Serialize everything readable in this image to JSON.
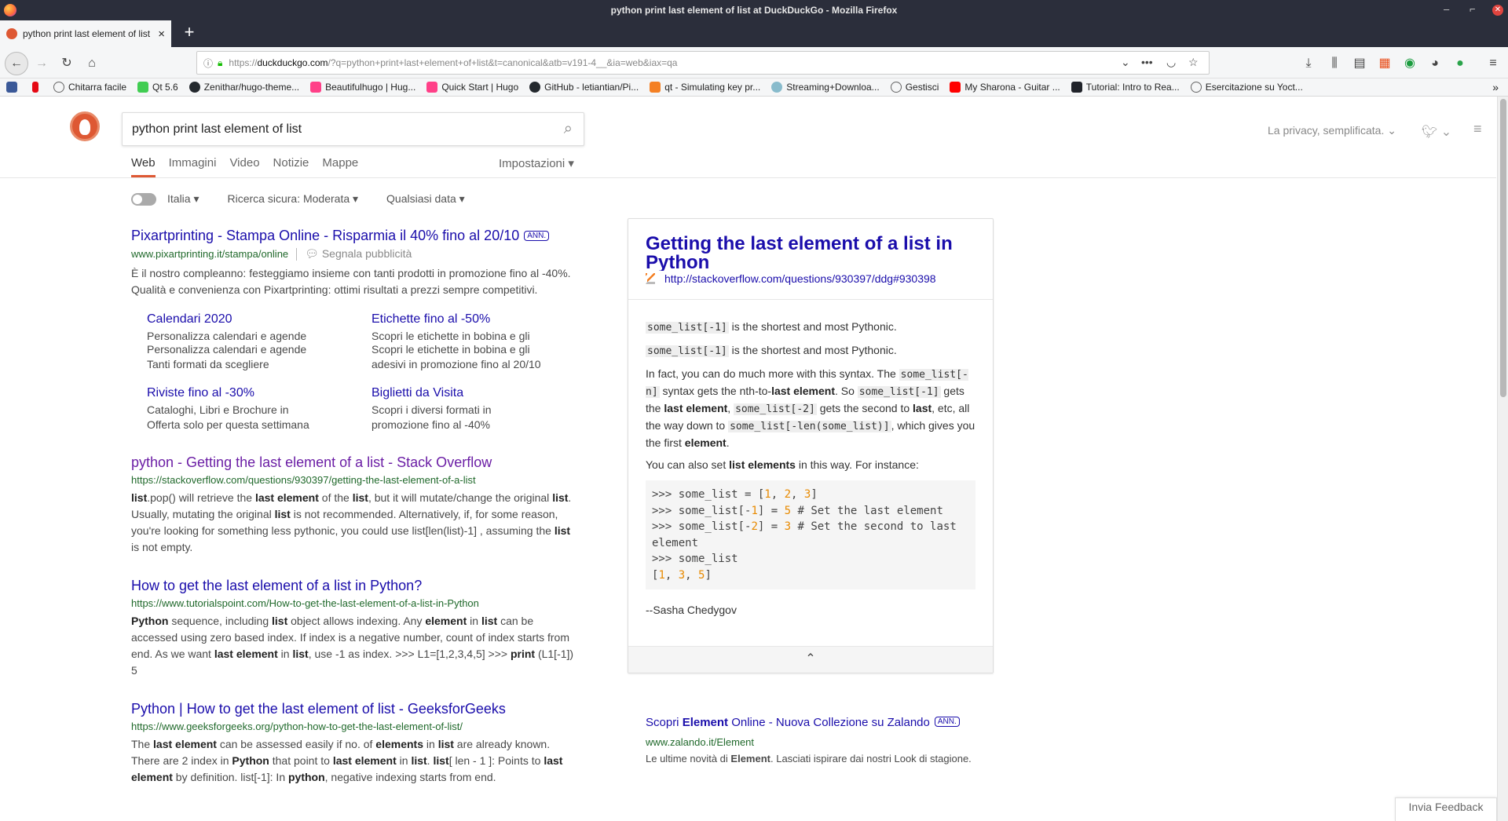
{
  "window": {
    "title": "python print last element of list at DuckDuckGo - Mozilla Firefox"
  },
  "tab": {
    "title": "python print last element of list"
  },
  "url": {
    "prefix": "https://",
    "domain": "duckduckgo.com",
    "path": "/?q=python+print+last+element+of+list&t=canonical&atb=v191-4__&ia=web&iax=qa"
  },
  "bookmarks": [
    {
      "label": "",
      "color": "#3b5998"
    },
    {
      "label": "",
      "color": "#e50914"
    },
    {
      "label": "Chitarra facile",
      "color": "#666666"
    },
    {
      "label": "Qt 5.6",
      "color": "#41cd52"
    },
    {
      "label": "Zenithar/hugo-theme...",
      "color": "#24292e"
    },
    {
      "label": "Beautifulhugo | Hug...",
      "color": "#ff4088"
    },
    {
      "label": "Quick Start | Hugo",
      "color": "#ff4088"
    },
    {
      "label": "GitHub - letiantian/Pi...",
      "color": "#24292e"
    },
    {
      "label": "qt - Simulating key pr...",
      "color": "#f48024"
    },
    {
      "label": "Streaming+Downloa...",
      "color": "#88bbcc"
    },
    {
      "label": "Gestisci",
      "color": "#666666"
    },
    {
      "label": "My Sharona - Guitar ...",
      "color": "#ff0000"
    },
    {
      "label": "Tutorial: Intro to Rea...",
      "color": "#20232a"
    },
    {
      "label": "Esercitazione su Yoct...",
      "color": "#666666"
    }
  ],
  "search": {
    "query": "python print last element of list"
  },
  "header": {
    "privacy": "La privacy, semplificata.",
    "privacy_arrow": "⌄"
  },
  "nav": {
    "web": "Web",
    "images": "Immagini",
    "video": "Video",
    "news": "Notizie",
    "maps": "Mappe",
    "settings": "Impostazioni"
  },
  "filters": {
    "region": "Italia",
    "safe": "Ricerca sicura: Moderata",
    "date": "Qualsiasi data"
  },
  "ad": {
    "title": "Pixartprinting - Stampa Online - Risparmia il 40% fino al 20/10",
    "badge": "ANN.",
    "url": "www.pixartprinting.it/stampa/online",
    "report": "Segnala pubblicità",
    "snippet": "È il nostro compleanno: festeggiamo insieme con tanti prodotti in promozione fino al -40%. Qualità e convenienza con Pixartprinting: ottimi risultati a prezzi sempre competitivi.",
    "sitelinks": [
      {
        "title": "Calendari 2020",
        "l1": "Personalizza calendari e agende",
        "l2": "Personalizza calendari e agende",
        "l3": "Tanti formati da scegliere"
      },
      {
        "title": "Etichette fino al -50%",
        "l1": "Scopri le etichette in bobina e gli",
        "l2": "Scopri le etichette in bobina e gli",
        "l3": "adesivi in promozione fino al 20/10"
      },
      {
        "title": "Riviste fino al -30%",
        "l1": "Cataloghi, Libri e Brochure in",
        "l2": "Offerta solo per questa settimana",
        "l3": ""
      },
      {
        "title": "Biglietti da Visita",
        "l1": "Scopri i diversi formati in",
        "l2": "promozione fino al -40%",
        "l3": ""
      }
    ]
  },
  "results": [
    {
      "title": "python - Getting the last element of a list - Stack Overflow",
      "url": "https://stackoverflow.com/questions/930397/getting-the-last-element-of-a-list"
    },
    {
      "title": "How to get the last element of a list in Python?",
      "url": "https://www.tutorialspoint.com/How-to-get-the-last-element-of-a-list-in-Python"
    },
    {
      "title": "Python | How to get the last element of list - GeeksforGeeks",
      "url": "https://www.geeksforgeeks.org/python-how-to-get-the-last-element-of-list/"
    }
  ],
  "infobox": {
    "title": "Getting the last element of a list in Python",
    "source_url": "http://stackoverflow.com/questions/930397/ddg#930398",
    "author": "--Sasha Chedygov",
    "collapse": "⌃"
  },
  "side_ad": {
    "title_pre": "Scopri ",
    "title_bold": "Element",
    "title_post": " Online - Nuova Collezione su Zalando",
    "badge": "ANN.",
    "url": "www.zalando.it/Element",
    "snippet_pre": "Le ultime novità di ",
    "snippet_bold": "Element",
    "snippet_post": ". Lasciati ispirare dai nostri Look di stagione."
  },
  "feedback": "Invia Feedback"
}
